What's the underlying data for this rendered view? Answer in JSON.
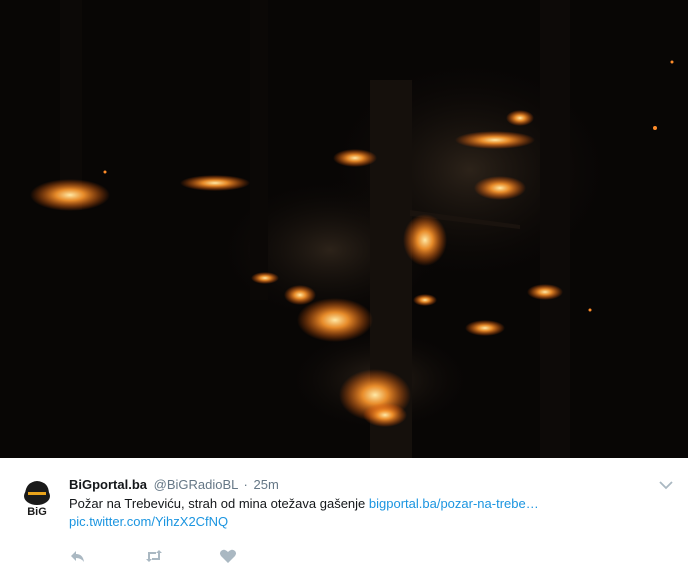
{
  "media": {
    "icon": "forest-fire-photo",
    "description_icon": "photo"
  },
  "tweet": {
    "display_name": "BiGportal.ba",
    "handle": "@BiGRadioBL",
    "separator": "·",
    "timestamp": "25m",
    "text": "Požar na Trebeviću, strah od mina otežava gašenje ",
    "link": "bigportal.ba/pozar-na-trebe…",
    "pic_link": "pic.twitter.com/YihzX2CfNQ",
    "avatar_label": "BiG",
    "colors": {
      "link": "#1b95e0",
      "text": "#14171a",
      "secondary": "#657786",
      "avatar_orange": "#e8a31b"
    }
  },
  "actions": {
    "reply_icon": "reply-icon",
    "retweet_icon": "retweet-icon",
    "like_icon": "heart-icon",
    "more_icon": "chevron-down-icon"
  }
}
